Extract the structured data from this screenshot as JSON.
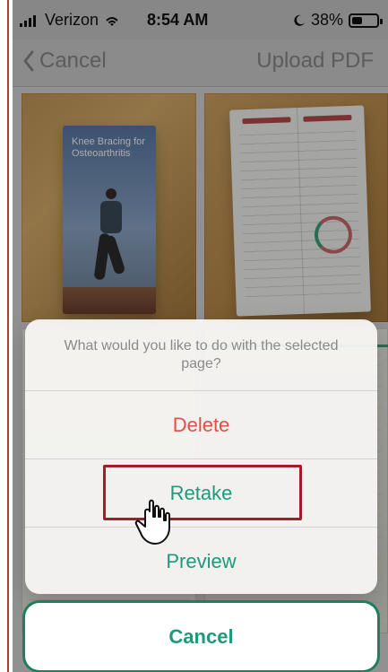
{
  "statusbar": {
    "carrier": "Verizon",
    "time": "8:54 AM",
    "battery": "38%",
    "battery_level": 0.38
  },
  "navbar": {
    "back_label": "Cancel",
    "action_label": "Upload PDF"
  },
  "thumbnails": {
    "brochure_title": "Knee Bracing for Osteoarthritis"
  },
  "action_sheet": {
    "message": "What would you like to do with the selected page?",
    "actions": [
      {
        "label": "Delete",
        "color": "#e24f45"
      },
      {
        "label": "Retake",
        "color": "#1e9a7b"
      },
      {
        "label": "Preview",
        "color": "#1e9a7b"
      }
    ]
  },
  "cancel": {
    "label": "Cancel",
    "color": "#1e9a7b"
  },
  "icons": {
    "back": "chevron-left-icon",
    "wifi": "wifi-icon",
    "signal": "signal-bars-icon",
    "moon": "moon-icon",
    "battery": "battery-icon",
    "hand": "hand-cursor-icon"
  }
}
